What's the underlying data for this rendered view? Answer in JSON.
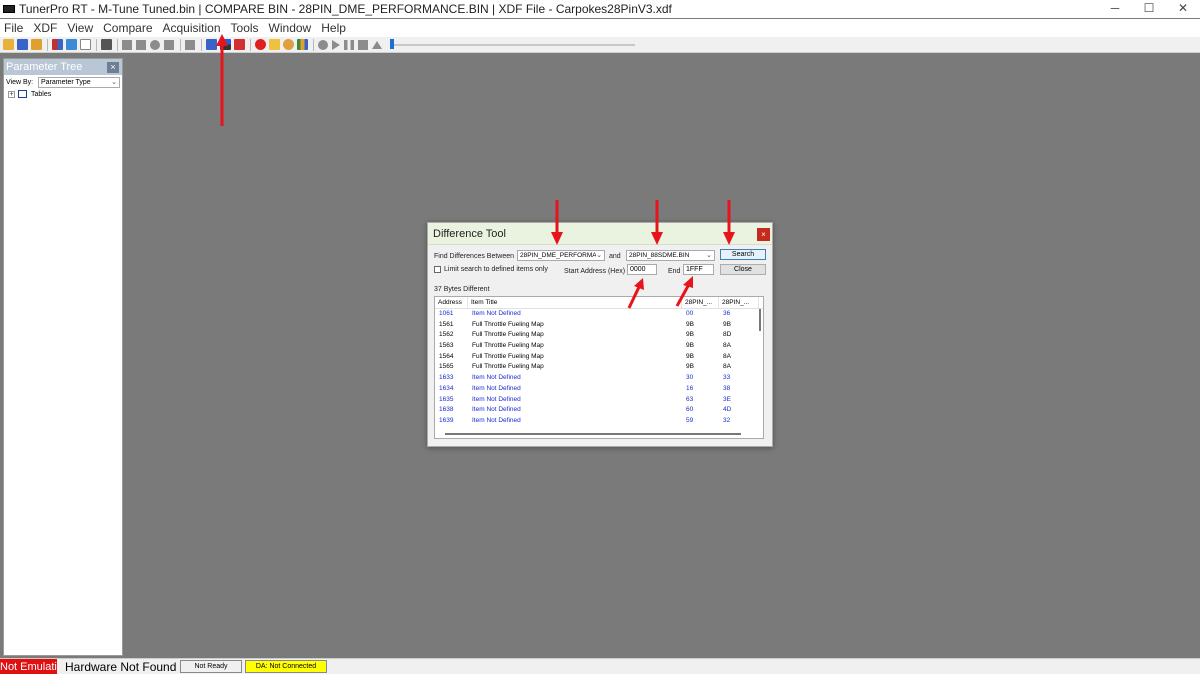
{
  "window": {
    "title": "TunerPro RT - M-Tune Tuned.bin | COMPARE BIN - 28PIN_DME_PERFORMANCE.BIN | XDF File - Carpokes28PinV3.xdf",
    "controls": [
      "─",
      "☐",
      "✕"
    ]
  },
  "menu": [
    "File",
    "XDF",
    "View",
    "Compare",
    "Acquisition",
    "Tools",
    "Window",
    "Help"
  ],
  "toolbar": {
    "icons": [
      "open-icon",
      "save-icon",
      "save-as-icon",
      "chart-icon",
      "new-icon",
      "eraser-icon",
      "arrow-up-icon",
      "arrow-down-icon",
      "circle-icon",
      "copy-icon",
      "keyboard-icon",
      "compare-icon",
      "swap-icon",
      "find-icon",
      "record-icon",
      "folder-icon",
      "globe-icon",
      "graph-icon",
      "play-icon",
      "pause-icon",
      "stop-icon",
      "eject-icon"
    ],
    "slider_position": 0.0
  },
  "parameter_tree": {
    "title": "Parameter Tree",
    "close": "×",
    "view_by_label": "View By:",
    "view_by_value": "Parameter Type",
    "node_label": "Tables",
    "expander": "+"
  },
  "dialog": {
    "title": "Difference Tool",
    "close": "×",
    "find_label": "Find Differences Between",
    "file_a": "28PIN_DME_PERFORMA",
    "and_label": "and",
    "file_b": "28PIN_88SDME.BIN",
    "search_button": "Search",
    "close_button": "Close",
    "limit_label": "Limit search to defined items only",
    "start_label": "Start Address (Hex)",
    "start_value": "0000",
    "end_label": "End",
    "end_value": "1FFF",
    "result_summary": "37 Bytes Different",
    "columns": [
      "Address",
      "Item Title",
      "28PIN_...",
      "28PIN_..."
    ],
    "rows": [
      {
        "address": "1061",
        "title": "Item Not Defined",
        "a": "00",
        "b": "36",
        "defined": false
      },
      {
        "address": "1561",
        "title": "Full Throttle Fueling Map",
        "a": "9B",
        "b": "9B",
        "defined": true
      },
      {
        "address": "1562",
        "title": "Full Throttle Fueling Map",
        "a": "9B",
        "b": "8D",
        "defined": true
      },
      {
        "address": "1563",
        "title": "Full Throttle Fueling Map",
        "a": "9B",
        "b": "8A",
        "defined": true
      },
      {
        "address": "1564",
        "title": "Full Throttle Fueling Map",
        "a": "9B",
        "b": "8A",
        "defined": true
      },
      {
        "address": "1565",
        "title": "Full Throttle Fueling Map",
        "a": "9B",
        "b": "8A",
        "defined": true
      },
      {
        "address": "1633",
        "title": "Item Not Defined",
        "a": "30",
        "b": "33",
        "defined": false
      },
      {
        "address": "1634",
        "title": "Item Not Defined",
        "a": "16",
        "b": "38",
        "defined": false
      },
      {
        "address": "1635",
        "title": "Item Not Defined",
        "a": "63",
        "b": "3E",
        "defined": false
      },
      {
        "address": "1638",
        "title": "Item Not Defined",
        "a": "60",
        "b": "4D",
        "defined": false
      },
      {
        "address": "1639",
        "title": "Item Not Defined",
        "a": "59",
        "b": "32",
        "defined": false
      }
    ],
    "colors": {
      "defined": "#000000",
      "undefined": "#1a2ccf"
    }
  },
  "status": {
    "emulation": "Not Emulating",
    "hardware": "Hardware Not Found",
    "ready": "Not Ready",
    "da": "DA: Not Connected"
  },
  "colors": {
    "annotation_arrow": "#e8141b",
    "workspace": "#7a7a7a",
    "status_red": "#e01010",
    "status_yellow": "#ffff00"
  }
}
